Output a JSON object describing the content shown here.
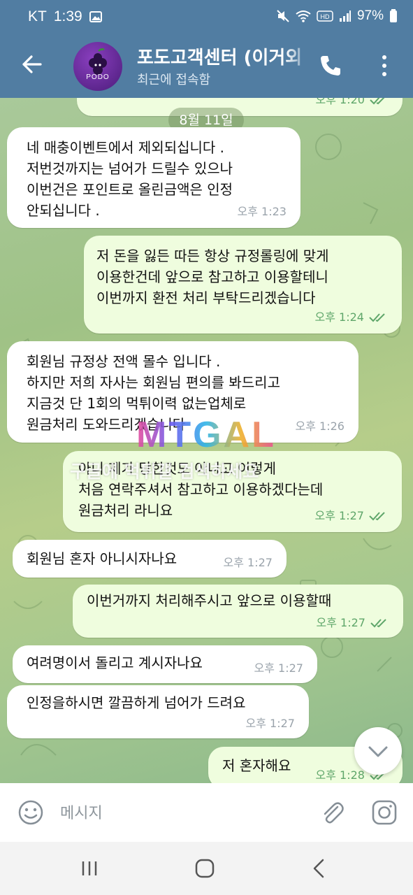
{
  "status_bar": {
    "carrier": "KT",
    "time": "1:39",
    "battery": "97%"
  },
  "header": {
    "title": "포도고객센터 (이거외",
    "subtitle": "최근에 접속함",
    "avatar_text": "PODO",
    "accent": "#517da2"
  },
  "chat": {
    "top_partial_time": "오후 1:20",
    "date_label": "8월 11일",
    "messages": [
      {
        "dir": "in",
        "text": "네 매충이벤트에서 제외되십니다 .\n저번것까지는 넘어가 드릴수 있으나\n이번건은 포인트로 올린금액은 인정\n안되십니다  .",
        "time": "오후 1:23"
      },
      {
        "dir": "out",
        "text": "저 돈을 잃든 따든 항상 규정롤링에 맞게\n이용한건데 앞으로 참고하고 이용할테니\n이번까지 환전 처리 부탁드리겠습니다",
        "time": "오후 1:24"
      },
      {
        "dir": "in",
        "text": "회원님 규정상 전액 몰수 입니다 .\n하지만 저희 자사는 회원님 편의를 봐드리고\n지금것 단 1회의 먹튀이력 없는업체로\n원금처리 도와드리겠습니다",
        "time": "오후 1:26"
      },
      {
        "dir": "out",
        "text": "아니 제가 당한것도 아니고 이렇게\n처음 연락주셔서 참고하고 이용하겠다는데\n원금처리 라니요",
        "time": "오후 1:27"
      },
      {
        "dir": "in",
        "text": "회원님 혼자 아니시자나요",
        "time": "오후 1:27"
      },
      {
        "dir": "out",
        "text": "이번거까지 처리해주시고 앞으로 이용할때",
        "time": "오후 1:27"
      },
      {
        "dir": "in",
        "text": "여려명이서 돌리고 계시자나요",
        "time": "오후 1:27"
      },
      {
        "dir": "in",
        "text": "인정을하시면 깔끔하게 넘어가 드려요",
        "time": "오후 1:27"
      },
      {
        "dir": "out",
        "text": "저 혼자해요",
        "time": "오후 1:28"
      }
    ]
  },
  "watermark": {
    "logo": "MTGAL",
    "caption": "구글에 먹튀갤 검색하세요"
  },
  "input": {
    "placeholder": "메시지"
  }
}
